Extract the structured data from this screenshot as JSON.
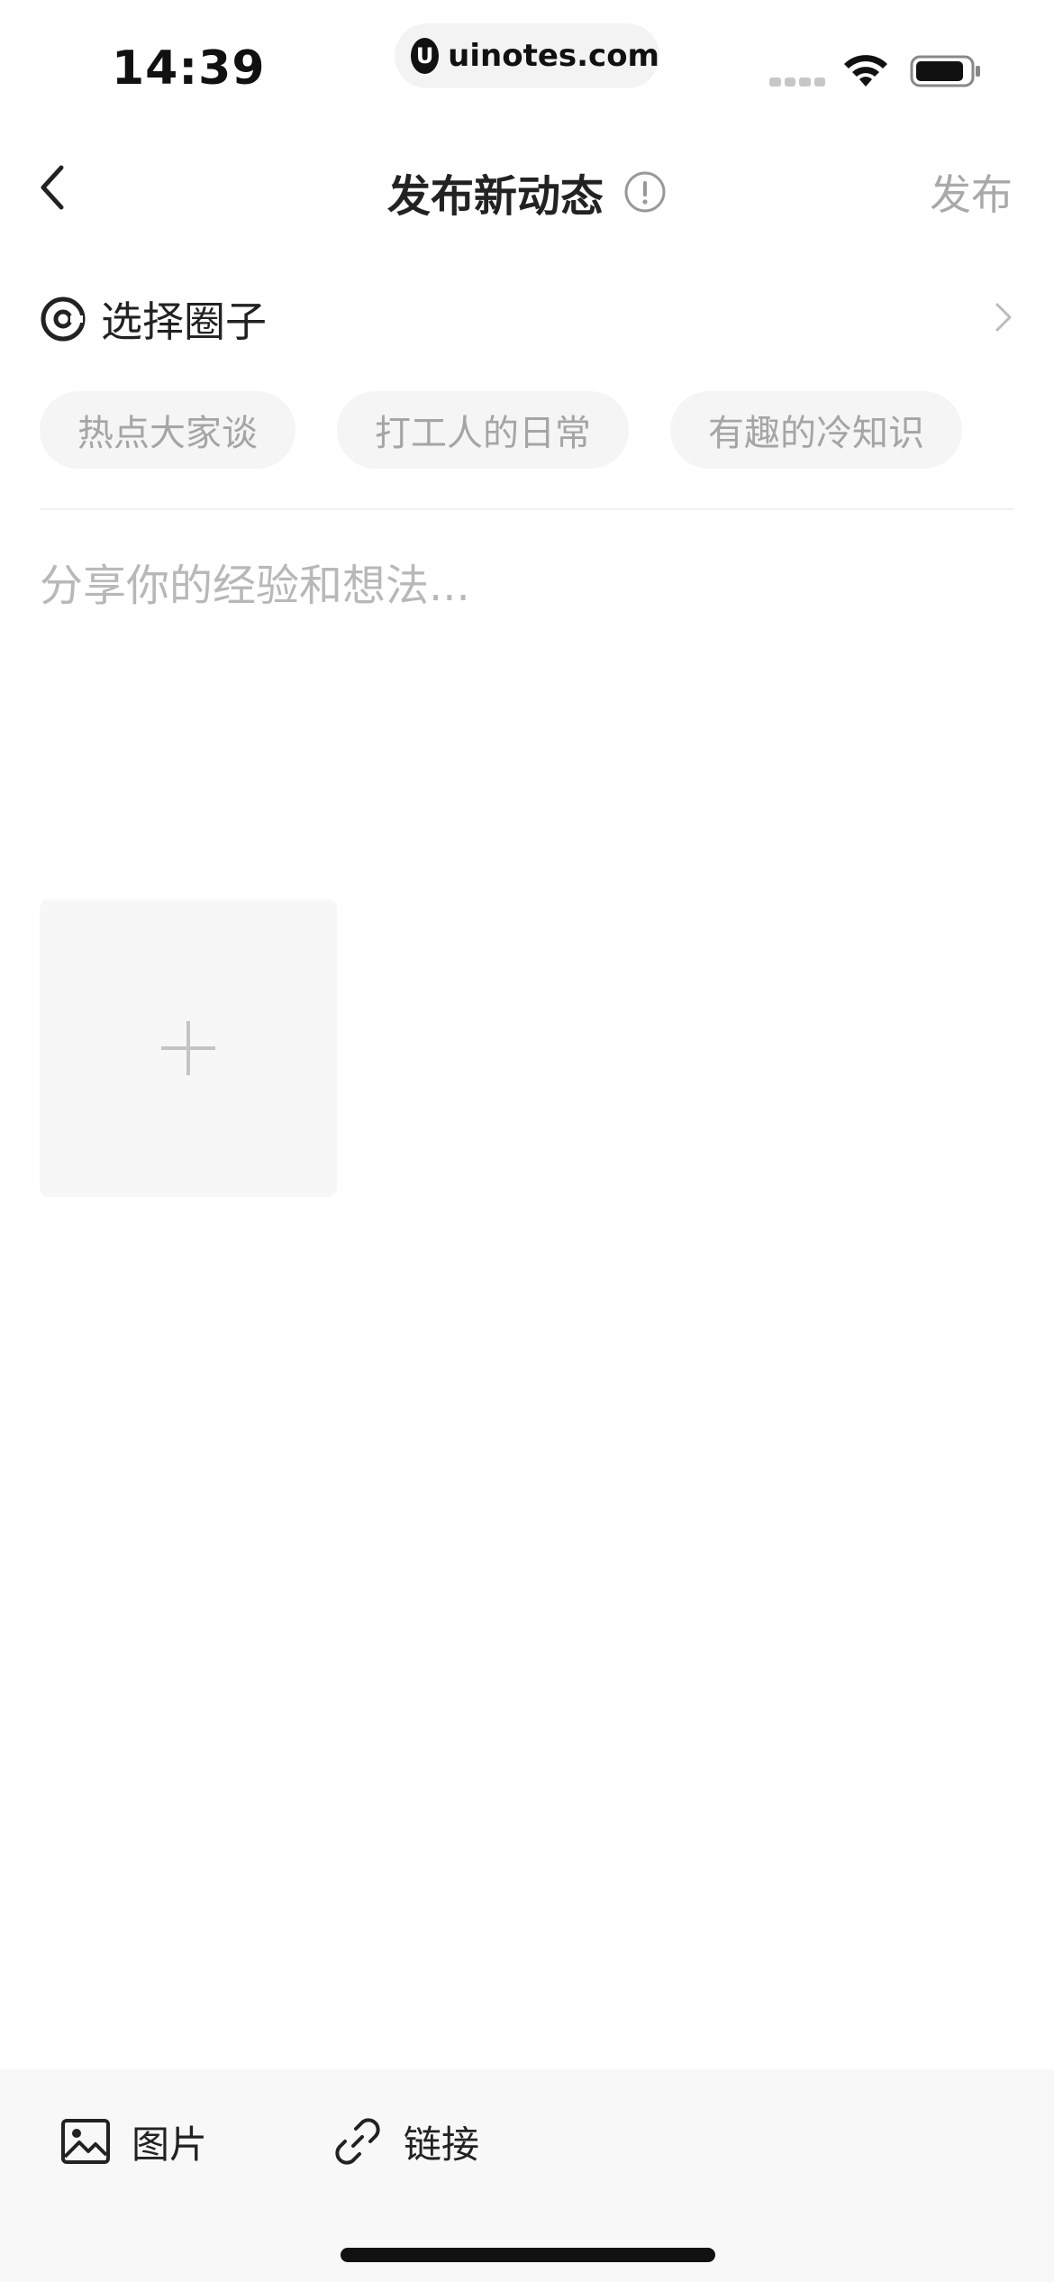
{
  "status_bar": {
    "time": "14:39",
    "url": "uinotes.com",
    "logo_letter": "U"
  },
  "header": {
    "title": "发布新动态",
    "publish_label": "发布"
  },
  "circle": {
    "label": "选择圈子",
    "tags": [
      "热点大家谈",
      "打工人的日常",
      "有趣的冷知识"
    ]
  },
  "composer": {
    "placeholder": "分享你的经验和想法..."
  },
  "toolbar": {
    "image_label": "图片",
    "link_label": "链接"
  },
  "colors": {
    "accent_text": "#222222",
    "muted_text": "#a9a9a9",
    "tag_bg": "#f5f5f5",
    "toolbar_bg": "#f8f8f8"
  }
}
